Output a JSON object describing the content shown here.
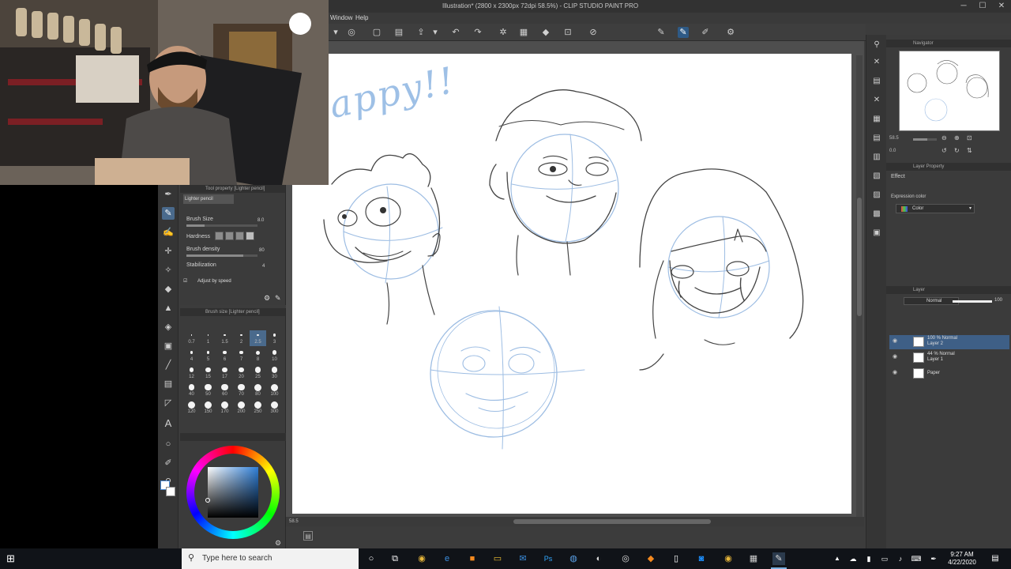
{
  "window": {
    "title": "Illustration* (2800 x 2300px 72dpi 58.5%) - CLIP STUDIO PAINT PRO",
    "controls": [
      "─",
      "☐",
      "✕"
    ]
  },
  "menu": {
    "items": [
      "Window",
      "Help"
    ]
  },
  "tool_property": {
    "header": "Tool property [Lighter pencil]",
    "tab": "Lighter pencil",
    "brush_size_label": "Brush Size",
    "brush_size_value": "8.0",
    "brush_size_level": 0.25,
    "hardness_label": "Hardness",
    "brush_density_label": "Brush density",
    "brush_density_value": "80",
    "brush_density_level": 0.8,
    "stabilization_label": "Stabilization",
    "stabilization_value": "4",
    "adjust_speed_label": "Adjust by speed"
  },
  "brush_size_panel": {
    "header": "Brush size [Lighter pencil]",
    "sizes": [
      "0.7",
      "1",
      "1.5",
      "2",
      "2.5",
      "3",
      "4",
      "5",
      "6",
      "7",
      "8",
      "10",
      "12",
      "15",
      "17",
      "20",
      "25",
      "30",
      "40",
      "50",
      "60",
      "70",
      "80",
      "100",
      "120",
      "150",
      "170",
      "200",
      "250",
      "300"
    ],
    "selected": "2.5"
  },
  "canvas": {
    "zoom": "58.5",
    "handwriting": "appy!!"
  },
  "navigator": {
    "header": "Navigator",
    "zoom": "58.5",
    "rotation": "0.0"
  },
  "layer_property": {
    "header": "Layer Property",
    "effect_label": "Effect",
    "expression_color_label": "Expression color",
    "expression_color_value": "Color"
  },
  "layers": {
    "header": "Layer",
    "blend_mode": "Normal",
    "opacity": "100",
    "items": [
      {
        "meta": "100 % Normal",
        "name": "Layer 2",
        "selected": true
      },
      {
        "meta": "44 % Normal",
        "name": "Layer 1",
        "selected": false
      },
      {
        "meta": "",
        "name": "Paper",
        "selected": false
      }
    ]
  },
  "taskbar": {
    "search_placeholder": "Type here to search",
    "time": "9:27 AM",
    "date": "4/22/2020"
  },
  "colors": {
    "accent": "#3e5f86",
    "sketch_blue": "#8fb3df",
    "pencil": "#3a3a3a"
  }
}
